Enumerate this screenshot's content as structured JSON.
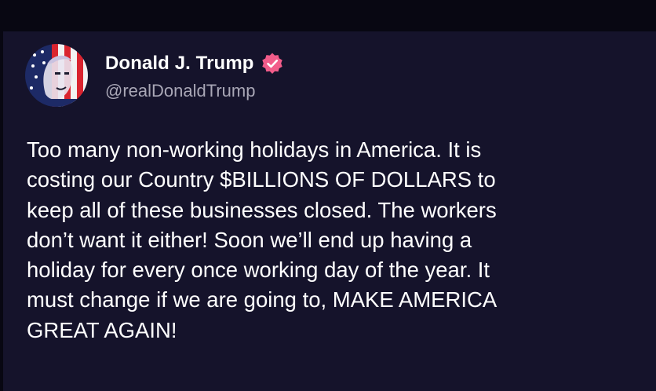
{
  "post": {
    "author": {
      "display_name": "Donald J. Trump",
      "handle": "@realDonaldTrump",
      "verified": true,
      "verified_icon": "verified-badge-icon",
      "avatar": "profile-avatar-image"
    },
    "text": "Too many non-working holidays in America. It is\ncosting our Country $BILLIONS OF DOLLARS to\nkeep all of these businesses closed. The workers\ndon’t want it either! Soon we’ll end up having a\nholiday for every once working day of the year. It\nmust change if we are going to, MAKE AMERICA\nGREAT AGAIN!"
  },
  "colors": {
    "page_background": "#080712",
    "card_background": "#15132b",
    "text_primary": "#ffffff",
    "text_secondary": "#a9a7b6",
    "verified_badge": "#f25c8a"
  }
}
